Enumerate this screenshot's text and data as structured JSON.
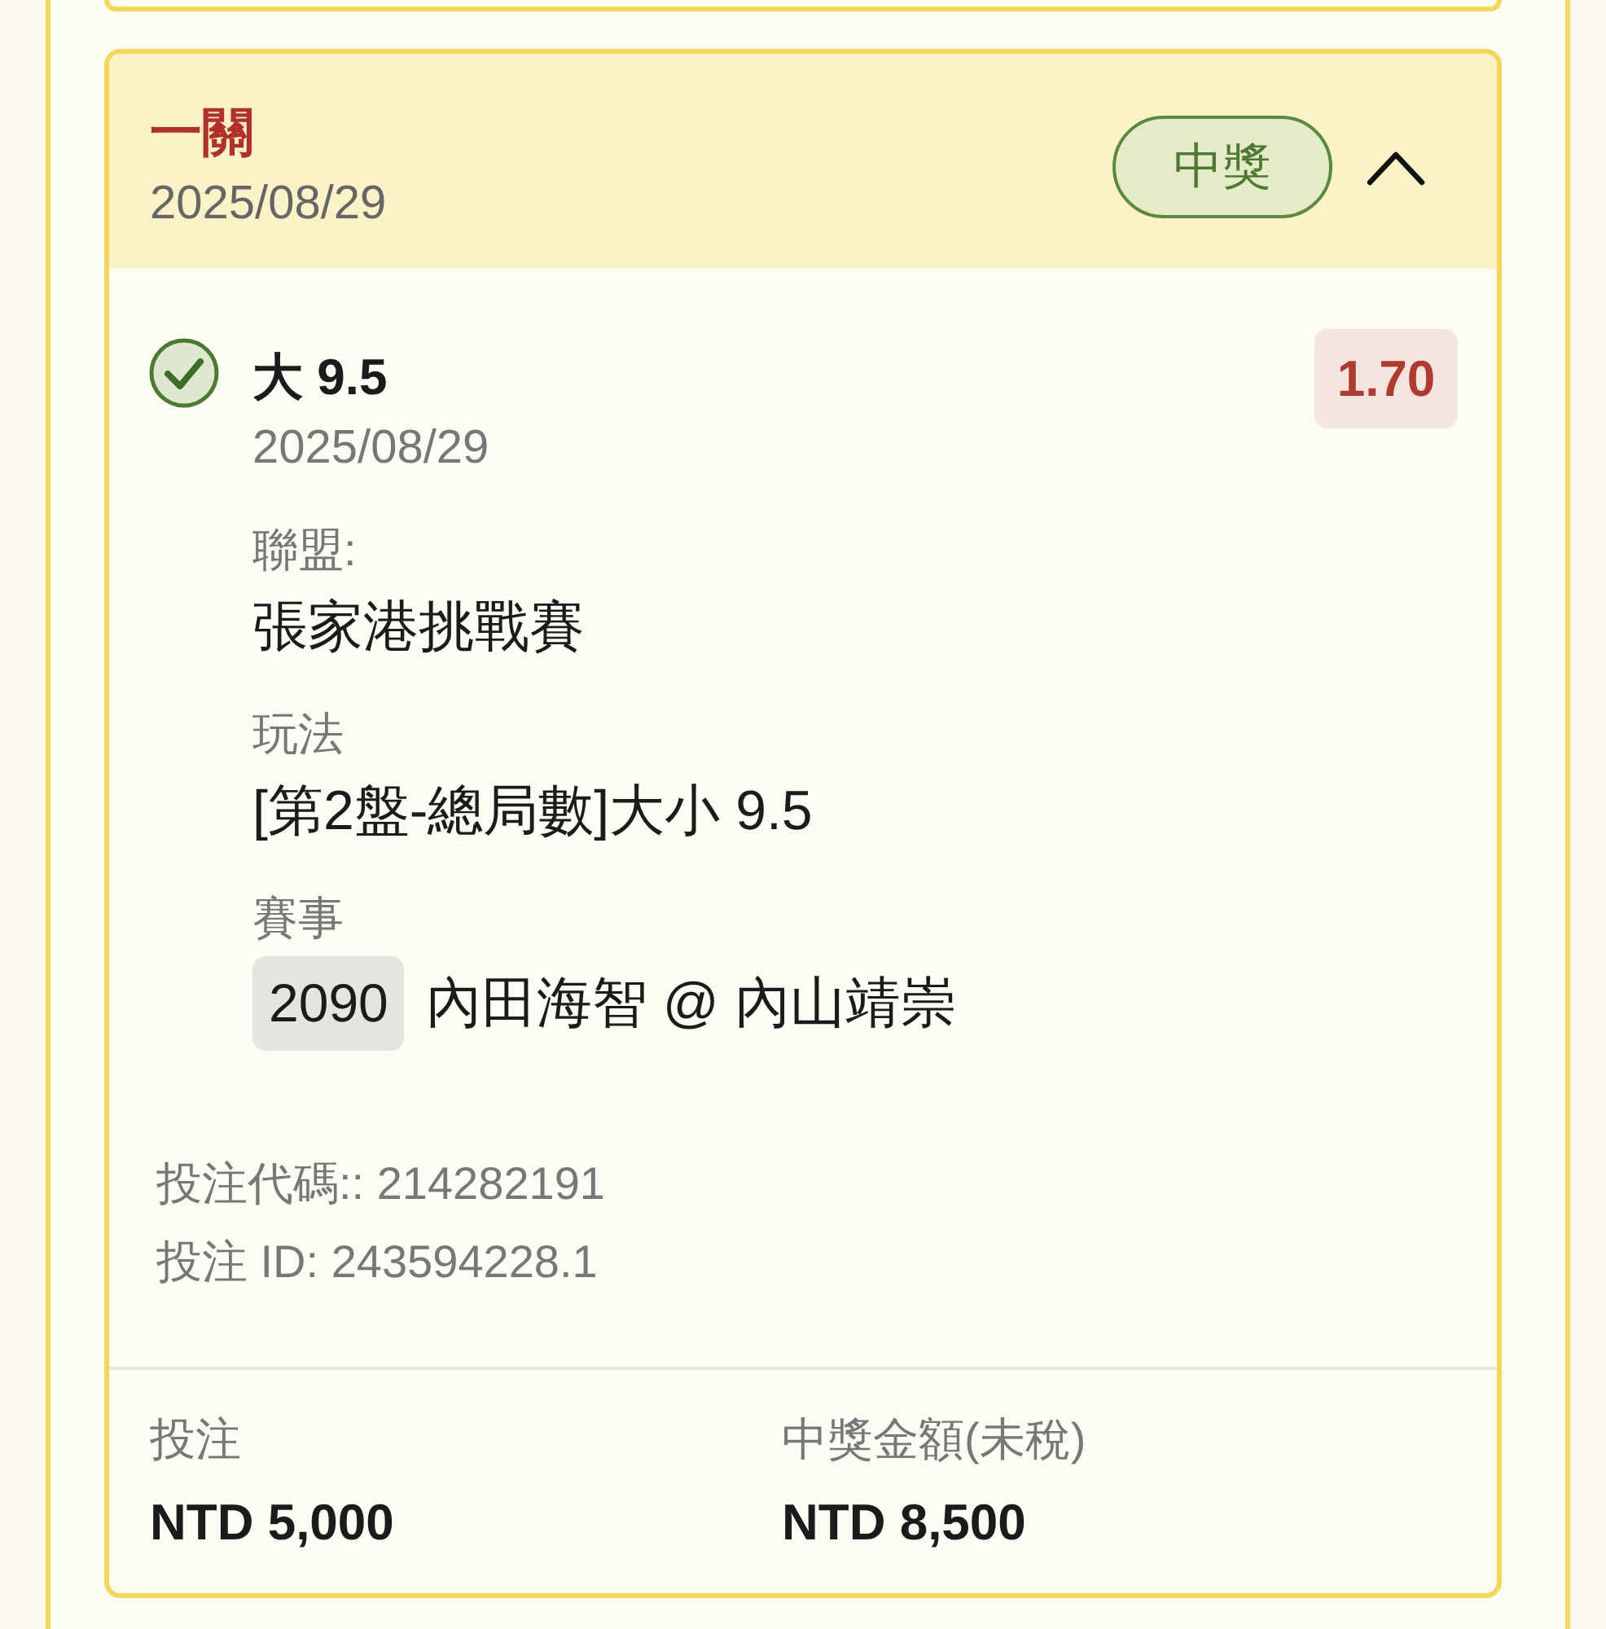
{
  "bet_card": {
    "title": "一關",
    "date": "2025/08/29",
    "status": {
      "label": "中獎",
      "kind": "won"
    },
    "expanded": true,
    "selections": [
      {
        "kind": "won",
        "name": "大 9.5",
        "date": "2025/08/29",
        "odds": "1.70",
        "fields": [
          {
            "kind": "text",
            "label": "聯盟:",
            "value": "張家港挑戰賽"
          },
          {
            "kind": "text",
            "label": "玩法",
            "value": "[第2盤-總局數]大小 9.5"
          },
          {
            "kind": "event",
            "label": "賽事",
            "event_code": "2090",
            "value": "內田海智 @ 內山靖崇"
          }
        ],
        "bet_code": "投注代碼:: 214282191",
        "bet_id": "投注 ID: 243594228.1"
      }
    ],
    "summary": [
      {
        "label": "投注",
        "value": "NTD 5,000"
      },
      {
        "label": "中獎金額(未稅)",
        "value": "NTD 8,500"
      }
    ]
  }
}
